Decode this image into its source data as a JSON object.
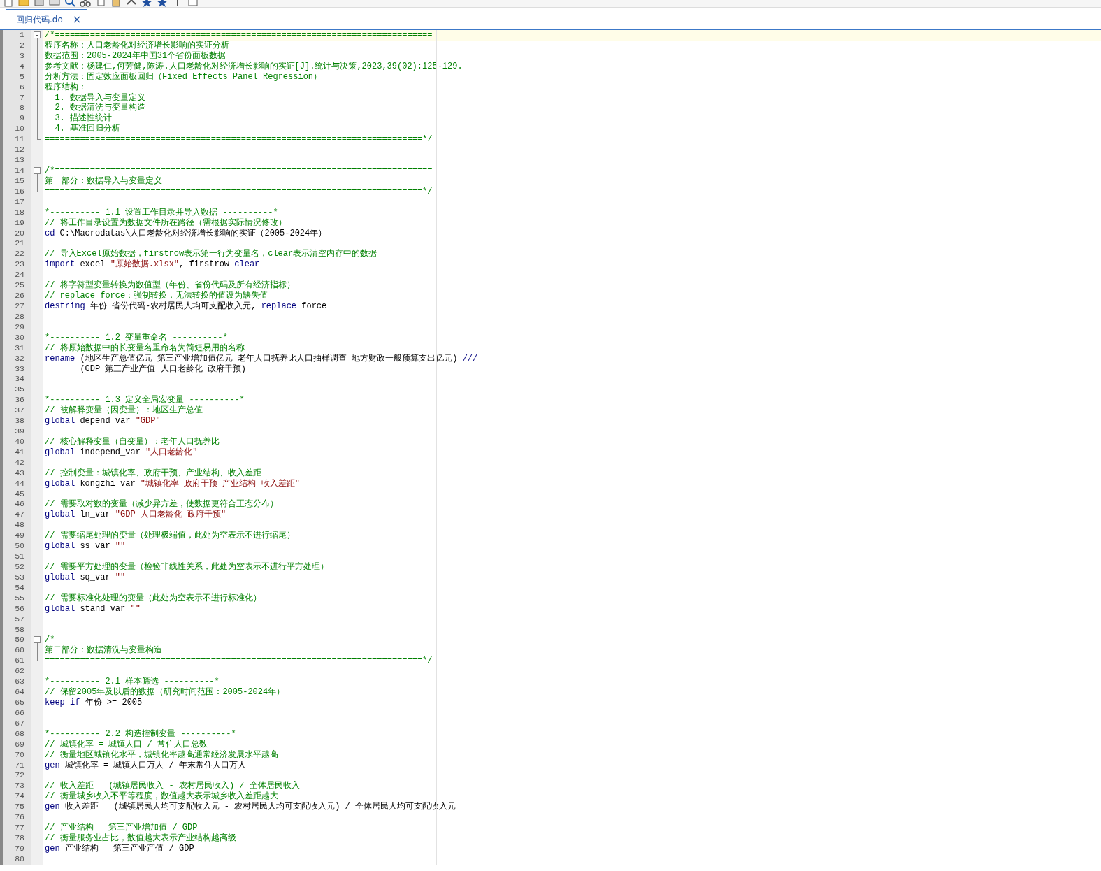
{
  "tabs": [
    {
      "label": "回归代码.do",
      "selected": true,
      "close": "×"
    }
  ],
  "lines": [
    {
      "number": "1",
      "current": true,
      "in_fold": true,
      "fold_toggle": {
        "expanded": true
      },
      "tokens": [
        {
          "kind": "comment",
          "text": "/*==========================================================================="
        }
      ]
    },
    {
      "number": "2",
      "current": false,
      "in_fold": true,
      "tokens": [
        {
          "kind": "comment",
          "text": "程序名称：人口老龄化对经济增长影响的实证分析"
        }
      ]
    },
    {
      "number": "3",
      "current": false,
      "in_fold": true,
      "tokens": [
        {
          "kind": "comment",
          "text": "数据范围：2005-2024年中国31个省份面板数据"
        }
      ]
    },
    {
      "number": "4",
      "current": false,
      "in_fold": true,
      "tokens": [
        {
          "kind": "comment",
          "text": "参考文献：杨建仁,何芳健,陈涛.人口老龄化对经济增长影响的实证[J].统计与决策,2023,39(02):125-129."
        }
      ]
    },
    {
      "number": "5",
      "current": false,
      "in_fold": true,
      "tokens": [
        {
          "kind": "comment",
          "text": "分析方法：固定效应面板回归（Fixed Effects Panel Regression）"
        }
      ]
    },
    {
      "number": "6",
      "current": false,
      "in_fold": true,
      "tokens": [
        {
          "kind": "comment",
          "text": "程序结构："
        }
      ]
    },
    {
      "number": "7",
      "current": false,
      "in_fold": true,
      "tokens": [
        {
          "kind": "comment",
          "text": "  1. 数据导入与变量定义"
        }
      ]
    },
    {
      "number": "8",
      "current": false,
      "in_fold": true,
      "tokens": [
        {
          "kind": "comment",
          "text": "  2. 数据清洗与变量构造"
        }
      ]
    },
    {
      "number": "9",
      "current": false,
      "in_fold": true,
      "tokens": [
        {
          "kind": "comment",
          "text": "  3. 描述性统计"
        }
      ]
    },
    {
      "number": "10",
      "current": false,
      "in_fold": true,
      "tokens": [
        {
          "kind": "comment",
          "text": "  4. 基准回归分析"
        }
      ]
    },
    {
      "number": "11",
      "current": false,
      "in_fold": true,
      "tokens": [
        {
          "kind": "comment",
          "text": "===========================================================================*/"
        }
      ]
    },
    {
      "number": "12",
      "current": false
    },
    {
      "number": "13",
      "current": false
    },
    {
      "number": "14",
      "current": false,
      "in_fold": true,
      "fold_toggle": {
        "expanded": true
      },
      "tokens": [
        {
          "kind": "comment",
          "text": "/*==========================================================================="
        }
      ]
    },
    {
      "number": "15",
      "current": false,
      "in_fold": true,
      "tokens": [
        {
          "kind": "comment",
          "text": "第一部分：数据导入与变量定义"
        }
      ]
    },
    {
      "number": "16",
      "current": false,
      "in_fold": true,
      "tokens": [
        {
          "kind": "comment",
          "text": "===========================================================================*/"
        }
      ]
    },
    {
      "number": "17",
      "current": false
    },
    {
      "number": "18",
      "current": false,
      "tokens": [
        {
          "kind": "comment",
          "text": "*---------- 1.1 设置工作目录并导入数据 ----------*"
        }
      ]
    },
    {
      "number": "19",
      "current": false,
      "tokens": [
        {
          "kind": "comment",
          "text": "// 将工作目录设置为数据文件所在路径（需根据实际情况修改）"
        }
      ]
    },
    {
      "number": "20",
      "current": false,
      "tokens": [
        {
          "kind": "keyword",
          "text": "cd"
        },
        {
          "kind": "text",
          "text": " C:\\Macrodatas\\人口老龄化对经济增长影响的实证（2005-2024年）"
        }
      ]
    },
    {
      "number": "21",
      "current": false
    },
    {
      "number": "22",
      "current": false,
      "tokens": [
        {
          "kind": "comment",
          "text": "// 导入Excel原始数据，firstrow表示第一行为变量名，clear表示清空内存中的数据"
        }
      ]
    },
    {
      "number": "23",
      "current": false,
      "tokens": [
        {
          "kind": "keyword",
          "text": "import"
        },
        {
          "kind": "text",
          "text": " excel "
        },
        {
          "kind": "string",
          "text": "\"原始数据.xlsx\""
        },
        {
          "kind": "text",
          "text": ", firstrow "
        },
        {
          "kind": "keyword",
          "text": "clear"
        }
      ]
    },
    {
      "number": "24",
      "current": false
    },
    {
      "number": "25",
      "current": false,
      "tokens": [
        {
          "kind": "comment",
          "text": "// 将字符型变量转换为数值型（年份、省份代码及所有经济指标）"
        }
      ]
    },
    {
      "number": "26",
      "current": false,
      "tokens": [
        {
          "kind": "comment",
          "text": "// replace force：强制转换，无法转换的值设为缺失值"
        }
      ]
    },
    {
      "number": "27",
      "current": false,
      "tokens": [
        {
          "kind": "keyword",
          "text": "destring"
        },
        {
          "kind": "text",
          "text": " 年份 省份代码-农村居民人均可支配收入元, "
        },
        {
          "kind": "keyword",
          "text": "replace"
        },
        {
          "kind": "text",
          "text": " force"
        }
      ]
    },
    {
      "number": "28",
      "current": false
    },
    {
      "number": "29",
      "current": false
    },
    {
      "number": "30",
      "current": false,
      "tokens": [
        {
          "kind": "comment",
          "text": "*---------- 1.2 变量重命名 ----------*"
        }
      ]
    },
    {
      "number": "31",
      "current": false,
      "tokens": [
        {
          "kind": "comment",
          "text": "// 将原始数据中的长变量名重命名为简短易用的名称"
        }
      ]
    },
    {
      "number": "32",
      "current": false,
      "tokens": [
        {
          "kind": "keyword",
          "text": "rename"
        },
        {
          "kind": "text",
          "text": " (地区生产总值亿元 第三产业增加值亿元 老年人口抚养比人口抽样调查 地方财政一般预算支出亿元) "
        },
        {
          "kind": "keyword",
          "text": "///"
        }
      ]
    },
    {
      "number": "33",
      "current": false,
      "tokens": [
        {
          "kind": "text",
          "text": "       (GDP 第三产业产值 人口老龄化 政府干预)"
        }
      ]
    },
    {
      "number": "34",
      "current": false
    },
    {
      "number": "35",
      "current": false
    },
    {
      "number": "36",
      "current": false,
      "tokens": [
        {
          "kind": "comment",
          "text": "*---------- 1.3 定义全局宏变量 ----------*"
        }
      ]
    },
    {
      "number": "37",
      "current": false,
      "tokens": [
        {
          "kind": "comment",
          "text": "// 被解释变量（因变量）：地区生产总值"
        }
      ]
    },
    {
      "number": "38",
      "current": false,
      "tokens": [
        {
          "kind": "keyword",
          "text": "global"
        },
        {
          "kind": "text",
          "text": " depend_var "
        },
        {
          "kind": "string",
          "text": "\"GDP\""
        }
      ]
    },
    {
      "number": "39",
      "current": false
    },
    {
      "number": "40",
      "current": false,
      "tokens": [
        {
          "kind": "comment",
          "text": "// 核心解释变量（自变量）：老年人口抚养比"
        }
      ]
    },
    {
      "number": "41",
      "current": false,
      "tokens": [
        {
          "kind": "keyword",
          "text": "global"
        },
        {
          "kind": "text",
          "text": " independ_var "
        },
        {
          "kind": "string",
          "text": "\"人口老龄化\""
        }
      ]
    },
    {
      "number": "42",
      "current": false
    },
    {
      "number": "43",
      "current": false,
      "tokens": [
        {
          "kind": "comment",
          "text": "// 控制变量：城镇化率、政府干预、产业结构、收入差距"
        }
      ]
    },
    {
      "number": "44",
      "current": false,
      "tokens": [
        {
          "kind": "keyword",
          "text": "global"
        },
        {
          "kind": "text",
          "text": " kongzhi_var "
        },
        {
          "kind": "string",
          "text": "\"城镇化率 政府干预 产业结构 收入差距\""
        }
      ]
    },
    {
      "number": "45",
      "current": false
    },
    {
      "number": "46",
      "current": false,
      "tokens": [
        {
          "kind": "comment",
          "text": "// 需要取对数的变量（减少异方差，使数据更符合正态分布）"
        }
      ]
    },
    {
      "number": "47",
      "current": false,
      "tokens": [
        {
          "kind": "keyword",
          "text": "global"
        },
        {
          "kind": "text",
          "text": " ln_var "
        },
        {
          "kind": "string",
          "text": "\"GDP 人口老龄化 政府干预\""
        }
      ]
    },
    {
      "number": "48",
      "current": false
    },
    {
      "number": "49",
      "current": false,
      "tokens": [
        {
          "kind": "comment",
          "text": "// 需要缩尾处理的变量（处理极端值，此处为空表示不进行缩尾）"
        }
      ]
    },
    {
      "number": "50",
      "current": false,
      "tokens": [
        {
          "kind": "keyword",
          "text": "global"
        },
        {
          "kind": "text",
          "text": " ss_var "
        },
        {
          "kind": "string",
          "text": "\"\""
        }
      ]
    },
    {
      "number": "51",
      "current": false
    },
    {
      "number": "52",
      "current": false,
      "tokens": [
        {
          "kind": "comment",
          "text": "// 需要平方处理的变量（检验非线性关系，此处为空表示不进行平方处理）"
        }
      ]
    },
    {
      "number": "53",
      "current": false,
      "tokens": [
        {
          "kind": "keyword",
          "text": "global"
        },
        {
          "kind": "text",
          "text": " sq_var "
        },
        {
          "kind": "string",
          "text": "\"\""
        }
      ]
    },
    {
      "number": "54",
      "current": false
    },
    {
      "number": "55",
      "current": false,
      "tokens": [
        {
          "kind": "comment",
          "text": "// 需要标准化处理的变量（此处为空表示不进行标准化）"
        }
      ]
    },
    {
      "number": "56",
      "current": false,
      "tokens": [
        {
          "kind": "keyword",
          "text": "global"
        },
        {
          "kind": "text",
          "text": " stand_var "
        },
        {
          "kind": "string",
          "text": "\"\""
        }
      ]
    },
    {
      "number": "57",
      "current": false
    },
    {
      "number": "58",
      "current": false
    },
    {
      "number": "59",
      "current": false,
      "in_fold": true,
      "fold_toggle": {
        "expanded": true
      },
      "tokens": [
        {
          "kind": "comment",
          "text": "/*==========================================================================="
        }
      ]
    },
    {
      "number": "60",
      "current": false,
      "in_fold": true,
      "tokens": [
        {
          "kind": "comment",
          "text": "第二部分：数据清洗与变量构造"
        }
      ]
    },
    {
      "number": "61",
      "current": false,
      "in_fold": true,
      "tokens": [
        {
          "kind": "comment",
          "text": "===========================================================================*/"
        }
      ]
    },
    {
      "number": "62",
      "current": false
    },
    {
      "number": "63",
      "current": false,
      "tokens": [
        {
          "kind": "comment",
          "text": "*---------- 2.1 样本筛选 ----------*"
        }
      ]
    },
    {
      "number": "64",
      "current": false,
      "tokens": [
        {
          "kind": "comment",
          "text": "// 保留2005年及以后的数据（研究时间范围：2005-2024年）"
        }
      ]
    },
    {
      "number": "65",
      "current": false,
      "tokens": [
        {
          "kind": "keyword",
          "text": "keep if"
        },
        {
          "kind": "text",
          "text": " 年份 >= 2005"
        }
      ]
    },
    {
      "number": "66",
      "current": false
    },
    {
      "number": "67",
      "current": false
    },
    {
      "number": "68",
      "current": false,
      "tokens": [
        {
          "kind": "comment",
          "text": "*---------- 2.2 构造控制变量 ----------*"
        }
      ]
    },
    {
      "number": "69",
      "current": false,
      "tokens": [
        {
          "kind": "comment",
          "text": "// 城镇化率 = 城镇人口 / 常住人口总数"
        }
      ]
    },
    {
      "number": "70",
      "current": false,
      "tokens": [
        {
          "kind": "comment",
          "text": "// 衡量地区城镇化水平，城镇化率越高通常经济发展水平越高"
        }
      ]
    },
    {
      "number": "71",
      "current": false,
      "tokens": [
        {
          "kind": "keyword",
          "text": "gen"
        },
        {
          "kind": "text",
          "text": " 城镇化率 = 城镇人口万人 / 年末常住人口万人"
        }
      ]
    },
    {
      "number": "72",
      "current": false
    },
    {
      "number": "73",
      "current": false,
      "tokens": [
        {
          "kind": "comment",
          "text": "// 收入差距 = (城镇居民收入 - 农村居民收入) / 全体居民收入"
        }
      ]
    },
    {
      "number": "74",
      "current": false,
      "tokens": [
        {
          "kind": "comment",
          "text": "// 衡量城乡收入不平等程度，数值越大表示城乡收入差距越大"
        }
      ]
    },
    {
      "number": "75",
      "current": false,
      "tokens": [
        {
          "kind": "keyword",
          "text": "gen"
        },
        {
          "kind": "text",
          "text": " 收入差距 = (城镇居民人均可支配收入元 - 农村居民人均可支配收入元) / 全体居民人均可支配收入元"
        }
      ]
    },
    {
      "number": "76",
      "current": false
    },
    {
      "number": "77",
      "current": false,
      "tokens": [
        {
          "kind": "comment",
          "text": "// 产业结构 = 第三产业增加值 / GDP"
        }
      ]
    },
    {
      "number": "78",
      "current": false,
      "tokens": [
        {
          "kind": "comment",
          "text": "// 衡量服务业占比，数值越大表示产业结构越高级"
        }
      ]
    },
    {
      "number": "79",
      "current": false,
      "tokens": [
        {
          "kind": "keyword",
          "text": "gen"
        },
        {
          "kind": "text",
          "text": " 产业结构 = 第三产业产值 / GDP"
        }
      ]
    },
    {
      "number": "80",
      "current": false
    }
  ]
}
